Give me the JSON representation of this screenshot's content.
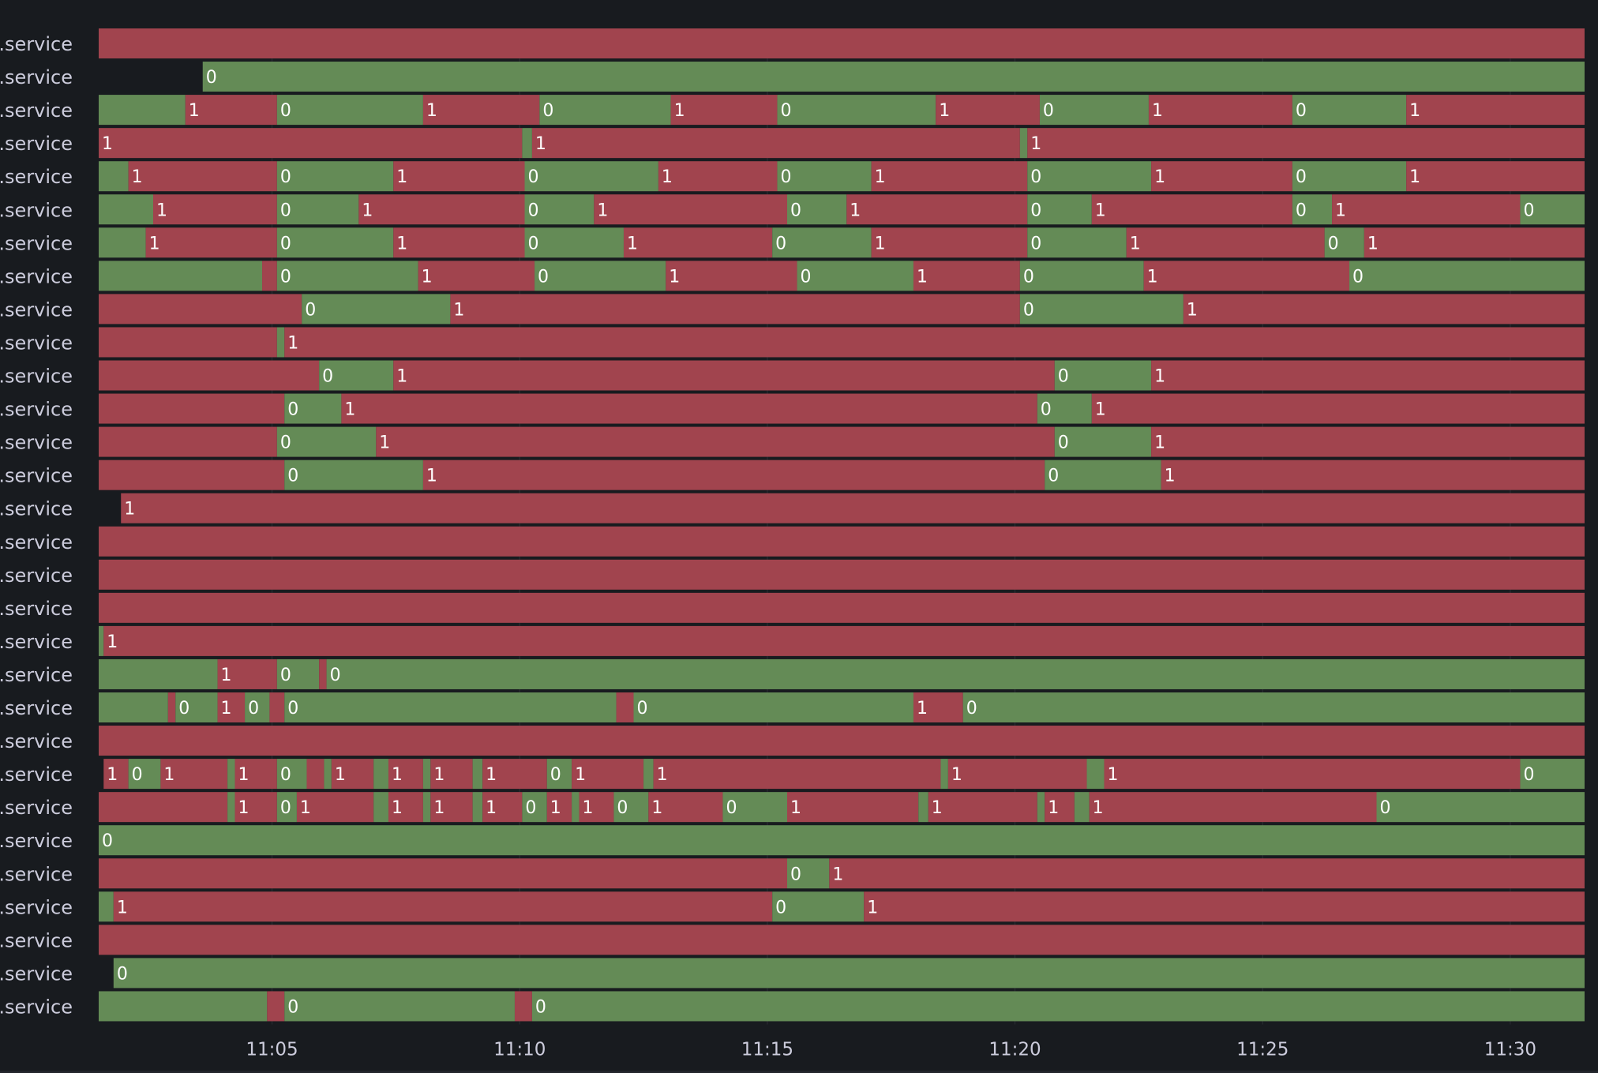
{
  "colors": {
    "background": "#181b1f",
    "state_1": "#a1444e",
    "state_0": "#648b56",
    "no_data": "#181b1f",
    "text": "#ccccdc",
    "value_text": "#ffffff",
    "grid": "#2c2f35"
  },
  "chart_data": {
    "type": "state-timeline",
    "x_axis": {
      "unit": "time (HH:MM)",
      "range": [
        1.5,
        31.5
      ],
      "ticks": [
        5,
        10,
        15,
        20,
        25,
        30
      ],
      "tick_labels": [
        "11:05",
        "11:10",
        "11:15",
        "11:20",
        "11:25",
        "11:30"
      ]
    },
    "legend": "none",
    "grid": true,
    "rows": [
      {
        "label": ".service",
        "segments": [
          [
            1.5,
            1,
            false
          ],
          [
            31.5,
            null,
            false
          ]
        ]
      },
      {
        "label": ".service",
        "segments": [
          [
            1.5,
            null,
            false
          ],
          [
            3.6,
            0,
            true
          ],
          [
            31.5,
            null,
            false
          ]
        ]
      },
      {
        "label": ".service",
        "segments": [
          [
            1.5,
            0,
            false
          ],
          [
            3.25,
            1,
            true
          ],
          [
            5.1,
            0,
            true
          ],
          [
            8.05,
            1,
            true
          ],
          [
            10.4,
            0,
            true
          ],
          [
            13.05,
            1,
            true
          ],
          [
            15.2,
            0,
            true
          ],
          [
            18.4,
            1,
            true
          ],
          [
            20.5,
            0,
            true
          ],
          [
            22.7,
            1,
            true
          ],
          [
            25.6,
            0,
            true
          ],
          [
            27.9,
            1,
            true
          ],
          [
            31.5,
            null,
            false
          ]
        ]
      },
      {
        "label": ".service",
        "segments": [
          [
            1.5,
            1,
            true
          ],
          [
            10.05,
            0,
            false
          ],
          [
            10.25,
            1,
            true
          ],
          [
            20.1,
            0,
            false
          ],
          [
            20.25,
            1,
            true
          ],
          [
            31.5,
            null,
            false
          ]
        ]
      },
      {
        "label": ".service",
        "segments": [
          [
            1.5,
            0,
            false
          ],
          [
            2.1,
            1,
            true
          ],
          [
            5.1,
            0,
            true
          ],
          [
            7.45,
            1,
            true
          ],
          [
            10.1,
            0,
            true
          ],
          [
            12.8,
            1,
            true
          ],
          [
            15.2,
            0,
            true
          ],
          [
            17.1,
            1,
            true
          ],
          [
            20.25,
            0,
            true
          ],
          [
            22.75,
            1,
            true
          ],
          [
            25.6,
            0,
            true
          ],
          [
            27.9,
            1,
            true
          ],
          [
            31.5,
            null,
            false
          ]
        ]
      },
      {
        "label": ".service",
        "segments": [
          [
            1.5,
            0,
            false
          ],
          [
            2.6,
            1,
            true
          ],
          [
            5.1,
            0,
            true
          ],
          [
            6.75,
            1,
            true
          ],
          [
            10.1,
            0,
            true
          ],
          [
            11.5,
            1,
            true
          ],
          [
            15.4,
            0,
            true
          ],
          [
            16.6,
            1,
            true
          ],
          [
            20.25,
            0,
            true
          ],
          [
            21.55,
            1,
            true
          ],
          [
            25.6,
            0,
            true
          ],
          [
            26.4,
            1,
            true
          ],
          [
            30.2,
            0,
            true
          ],
          [
            31.5,
            null,
            false
          ]
        ]
      },
      {
        "label": ".service",
        "segments": [
          [
            1.5,
            0,
            false
          ],
          [
            2.45,
            1,
            true
          ],
          [
            5.1,
            0,
            true
          ],
          [
            7.45,
            1,
            true
          ],
          [
            10.1,
            0,
            true
          ],
          [
            12.1,
            1,
            true
          ],
          [
            15.1,
            0,
            true
          ],
          [
            17.1,
            1,
            true
          ],
          [
            20.25,
            0,
            true
          ],
          [
            22.25,
            1,
            true
          ],
          [
            26.25,
            0,
            true
          ],
          [
            27.05,
            1,
            true
          ],
          [
            31.5,
            null,
            false
          ]
        ]
      },
      {
        "label": ".service",
        "segments": [
          [
            1.5,
            0,
            false
          ],
          [
            4.8,
            1,
            false
          ],
          [
            5.1,
            0,
            true
          ],
          [
            7.95,
            1,
            true
          ],
          [
            10.3,
            0,
            true
          ],
          [
            12.95,
            1,
            true
          ],
          [
            15.6,
            0,
            true
          ],
          [
            17.95,
            1,
            true
          ],
          [
            20.1,
            0,
            true
          ],
          [
            22.6,
            1,
            true
          ],
          [
            26.75,
            0,
            true
          ],
          [
            31.5,
            null,
            false
          ]
        ]
      },
      {
        "label": ".service",
        "segments": [
          [
            1.5,
            1,
            false
          ],
          [
            5.6,
            0,
            true
          ],
          [
            8.6,
            1,
            true
          ],
          [
            20.1,
            0,
            true
          ],
          [
            23.4,
            1,
            true
          ],
          [
            31.5,
            null,
            false
          ]
        ]
      },
      {
        "label": ".service",
        "segments": [
          [
            1.5,
            1,
            false
          ],
          [
            5.1,
            0,
            false
          ],
          [
            5.25,
            1,
            true
          ],
          [
            31.5,
            null,
            false
          ]
        ]
      },
      {
        "label": ".service",
        "segments": [
          [
            1.5,
            1,
            false
          ],
          [
            5.95,
            0,
            true
          ],
          [
            7.45,
            1,
            true
          ],
          [
            20.8,
            0,
            true
          ],
          [
            22.75,
            1,
            true
          ],
          [
            31.5,
            null,
            false
          ]
        ]
      },
      {
        "label": ".service",
        "segments": [
          [
            1.5,
            1,
            false
          ],
          [
            5.25,
            0,
            true
          ],
          [
            6.4,
            1,
            true
          ],
          [
            20.45,
            0,
            true
          ],
          [
            21.55,
            1,
            true
          ],
          [
            31.5,
            null,
            false
          ]
        ]
      },
      {
        "label": ".service",
        "segments": [
          [
            1.5,
            1,
            false
          ],
          [
            5.1,
            0,
            true
          ],
          [
            7.1,
            1,
            true
          ],
          [
            20.8,
            0,
            true
          ],
          [
            22.75,
            1,
            true
          ],
          [
            31.5,
            null,
            false
          ]
        ]
      },
      {
        "label": ".service",
        "segments": [
          [
            1.5,
            1,
            false
          ],
          [
            5.25,
            0,
            true
          ],
          [
            8.05,
            1,
            true
          ],
          [
            20.6,
            0,
            true
          ],
          [
            22.95,
            1,
            true
          ],
          [
            31.5,
            null,
            false
          ]
        ]
      },
      {
        "label": ".service",
        "segments": [
          [
            1.5,
            null,
            false
          ],
          [
            1.95,
            1,
            true
          ],
          [
            31.5,
            null,
            false
          ]
        ]
      },
      {
        "label": ".service",
        "segments": [
          [
            1.5,
            1,
            false
          ],
          [
            31.5,
            null,
            false
          ]
        ]
      },
      {
        "label": ".service",
        "segments": [
          [
            1.5,
            1,
            false
          ],
          [
            31.5,
            null,
            false
          ]
        ]
      },
      {
        "label": ".service",
        "segments": [
          [
            1.5,
            1,
            false
          ],
          [
            31.5,
            null,
            false
          ]
        ]
      },
      {
        "label": ".service",
        "segments": [
          [
            1.5,
            0,
            false
          ],
          [
            1.6,
            1,
            true
          ],
          [
            31.5,
            null,
            false
          ]
        ]
      },
      {
        "label": ".service",
        "segments": [
          [
            1.5,
            0,
            false
          ],
          [
            3.9,
            1,
            true
          ],
          [
            5.1,
            0,
            true
          ],
          [
            5.95,
            1,
            false
          ],
          [
            6.1,
            0,
            true
          ],
          [
            31.5,
            null,
            false
          ]
        ]
      },
      {
        "label": ".service",
        "segments": [
          [
            1.5,
            0,
            false
          ],
          [
            2.9,
            1,
            false
          ],
          [
            3.05,
            0,
            true
          ],
          [
            3.9,
            1,
            true
          ],
          [
            4.45,
            0,
            true
          ],
          [
            4.95,
            1,
            false
          ],
          [
            5.25,
            0,
            true
          ],
          [
            11.95,
            1,
            false
          ],
          [
            12.3,
            0,
            true
          ],
          [
            17.95,
            1,
            true
          ],
          [
            18.95,
            0,
            true
          ],
          [
            31.5,
            null,
            false
          ]
        ]
      },
      {
        "label": ".service",
        "segments": [
          [
            1.5,
            1,
            false
          ],
          [
            31.5,
            null,
            false
          ]
        ]
      },
      {
        "label": ".service",
        "segments": [
          [
            1.5,
            null,
            false
          ],
          [
            1.6,
            1,
            true
          ],
          [
            2.1,
            0,
            true
          ],
          [
            2.75,
            1,
            true
          ],
          [
            4.1,
            0,
            false
          ],
          [
            4.25,
            1,
            true
          ],
          [
            5.1,
            0,
            true
          ],
          [
            5.7,
            1,
            false
          ],
          [
            6.05,
            0,
            false
          ],
          [
            6.2,
            1,
            true
          ],
          [
            7.05,
            0,
            false
          ],
          [
            7.35,
            1,
            true
          ],
          [
            8.05,
            0,
            false
          ],
          [
            8.2,
            1,
            true
          ],
          [
            9.05,
            0,
            false
          ],
          [
            9.25,
            1,
            true
          ],
          [
            10.55,
            0,
            true
          ],
          [
            11.05,
            1,
            true
          ],
          [
            12.5,
            0,
            false
          ],
          [
            12.7,
            1,
            true
          ],
          [
            18.5,
            0,
            false
          ],
          [
            18.65,
            1,
            true
          ],
          [
            21.45,
            0,
            false
          ],
          [
            21.8,
            1,
            true
          ],
          [
            30.2,
            0,
            true
          ],
          [
            31.5,
            null,
            false
          ]
        ]
      },
      {
        "label": ".service",
        "segments": [
          [
            1.5,
            1,
            false
          ],
          [
            4.1,
            0,
            false
          ],
          [
            4.25,
            1,
            true
          ],
          [
            5.1,
            0,
            true
          ],
          [
            5.5,
            1,
            true
          ],
          [
            7.05,
            0,
            false
          ],
          [
            7.35,
            1,
            true
          ],
          [
            8.05,
            0,
            false
          ],
          [
            8.2,
            1,
            true
          ],
          [
            9.05,
            0,
            false
          ],
          [
            9.25,
            1,
            true
          ],
          [
            10.05,
            0,
            true
          ],
          [
            10.55,
            1,
            true
          ],
          [
            11.05,
            0,
            false
          ],
          [
            11.2,
            1,
            true
          ],
          [
            11.9,
            0,
            true
          ],
          [
            12.6,
            1,
            true
          ],
          [
            14.1,
            0,
            true
          ],
          [
            15.4,
            1,
            true
          ],
          [
            18.05,
            0,
            false
          ],
          [
            18.25,
            1,
            true
          ],
          [
            20.45,
            0,
            false
          ],
          [
            20.6,
            1,
            true
          ],
          [
            21.2,
            0,
            false
          ],
          [
            21.5,
            1,
            true
          ],
          [
            27.3,
            0,
            true
          ],
          [
            31.5,
            null,
            false
          ]
        ]
      },
      {
        "label": ".service",
        "segments": [
          [
            1.5,
            0,
            true
          ],
          [
            31.5,
            null,
            false
          ]
        ]
      },
      {
        "label": ".service",
        "segments": [
          [
            1.5,
            1,
            false
          ],
          [
            15.4,
            0,
            true
          ],
          [
            16.25,
            1,
            true
          ],
          [
            31.5,
            null,
            false
          ]
        ]
      },
      {
        "label": ".service",
        "segments": [
          [
            1.5,
            0,
            false
          ],
          [
            1.8,
            1,
            true
          ],
          [
            15.1,
            0,
            true
          ],
          [
            16.95,
            1,
            true
          ],
          [
            31.5,
            null,
            false
          ]
        ]
      },
      {
        "label": ".service",
        "segments": [
          [
            1.5,
            1,
            false
          ],
          [
            31.5,
            null,
            false
          ]
        ]
      },
      {
        "label": ".service",
        "segments": [
          [
            1.5,
            null,
            false
          ],
          [
            1.8,
            0,
            true
          ],
          [
            31.5,
            null,
            false
          ]
        ]
      },
      {
        "label": ".service",
        "segments": [
          [
            1.5,
            0,
            false
          ],
          [
            4.9,
            1,
            false
          ],
          [
            5.25,
            0,
            true
          ],
          [
            9.9,
            1,
            false
          ],
          [
            10.25,
            0,
            true
          ],
          [
            31.5,
            null,
            false
          ]
        ]
      }
    ]
  }
}
